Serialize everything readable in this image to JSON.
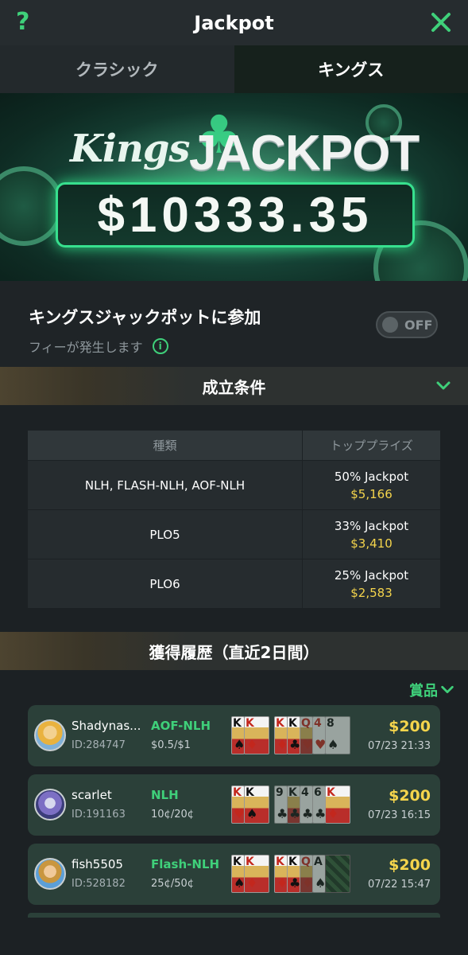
{
  "header": {
    "title": "Jackpot",
    "help": "?"
  },
  "tabs": [
    {
      "label": "クラシック",
      "active": false
    },
    {
      "label": "キングス",
      "active": true
    }
  ],
  "banner": {
    "kings": "Kings",
    "jackpot": "JACKPOT",
    "amount": "$10333.35"
  },
  "optin": {
    "title": "キングスジャックポットに参加",
    "subtitle": "フィーが発生します",
    "info": "i",
    "toggle_label": "OFF",
    "toggle_on": false
  },
  "conditions": {
    "heading": "成立条件",
    "columns": [
      "種類",
      "トッププライズ"
    ],
    "rows": [
      {
        "type": "NLH, FLASH-NLH, AOF-NLH",
        "percent": "50% Jackpot",
        "prize": "$5,166"
      },
      {
        "type": "PLO5",
        "percent": "33% Jackpot",
        "prize": "$3,410"
      },
      {
        "type": "PLO6",
        "percent": "25% Jackpot",
        "prize": "$2,583"
      }
    ]
  },
  "history": {
    "heading": "獲得履歴（直近2日間）",
    "filter_label": "賞品",
    "entries": [
      {
        "name": "Shadynas...",
        "id": "ID:284747",
        "game": "AOF-NLH",
        "stakes": "$0.5/$1",
        "amount": "$200",
        "time": "07/23 21:33"
      },
      {
        "name": "scarlet",
        "id": "ID:191163",
        "game": "NLH",
        "stakes": "10¢/20¢",
        "amount": "$200",
        "time": "07/23 16:15"
      },
      {
        "name": "fish5505",
        "id": "ID:528182",
        "game": "Flash-NLH",
        "stakes": "25¢/50¢",
        "amount": "$200",
        "time": "07/22 15:47"
      }
    ]
  },
  "colors": {
    "accent": "#3fd07a",
    "gold": "#f4d44c",
    "card_bg": "#2b4039",
    "background": "#1c2124"
  }
}
